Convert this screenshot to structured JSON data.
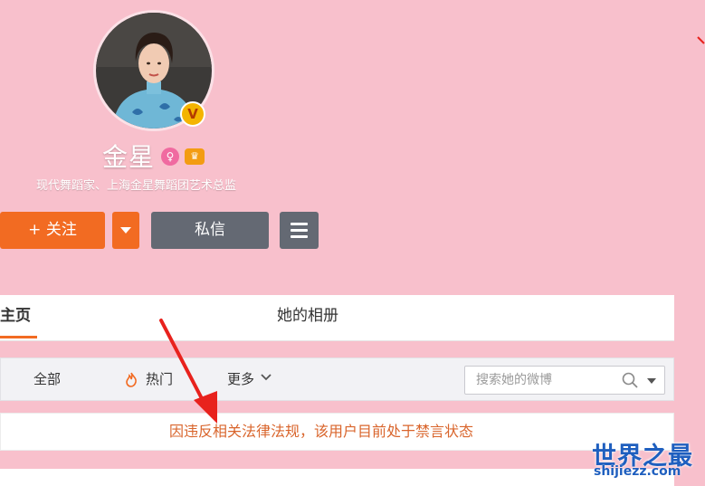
{
  "profile": {
    "name": "金星",
    "description": "现代舞蹈家、上海金星舞蹈团艺术总监",
    "verified_badge": "V",
    "female_icon": "female-icon",
    "member_icon": "member-crown-icon"
  },
  "actions": {
    "follow_label": "+ 关注",
    "message_label": "私信",
    "follow_dropdown_icon": "caret-down-icon",
    "menu_icon": "menu-icon"
  },
  "tabs": [
    {
      "label": "主页",
      "active": true
    },
    {
      "label": "她的相册",
      "active": false
    }
  ],
  "filters": {
    "all": "全部",
    "hot": "热门",
    "more": "更多"
  },
  "search": {
    "placeholder": "搜索她的微博",
    "value": ""
  },
  "notice": {
    "text": "因违反相关法律法规，该用户目前处于禁言状态"
  },
  "watermark": {
    "logo": "世界之最",
    "url": "shijiezz.com"
  },
  "colors": {
    "background": "#f8c0cc",
    "accent": "#f26b22",
    "secondary_button": "#646973",
    "notice_text": "#d9652c",
    "arrow": "#e8221d"
  }
}
